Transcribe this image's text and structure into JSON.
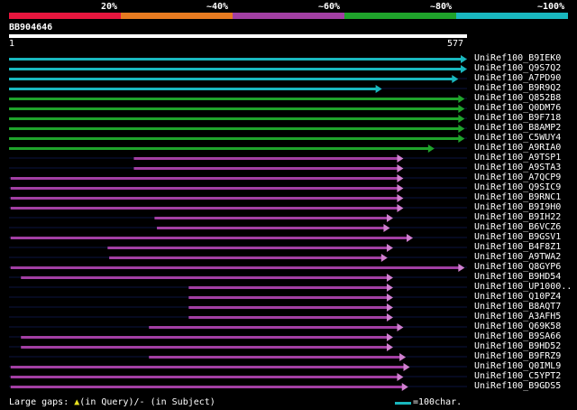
{
  "scale": {
    "labels": [
      "20%",
      "~40%",
      "~60%",
      "~80%",
      "~100%"
    ],
    "segment_colors": [
      "#e8163e",
      "#e87b20",
      "#a23fa3",
      "#1fa32b",
      "#19b7be"
    ]
  },
  "query": {
    "name": "BB904646",
    "start_label": "1",
    "end_label": "577",
    "length": 577
  },
  "footer": {
    "legend_prefix": "Large gaps:",
    "query_gap_text": "(in Query)/",
    "subject_gap_text": "- (in Subject)",
    "scale_text": "=100char.",
    "query_gap_color": "#e8e020",
    "scale_color": "#19b7be"
  },
  "hits": [
    {
      "name": "UniRef100_B9IEK0",
      "start": 1,
      "end": 577,
      "color": "#19b7be",
      "arrow_color": "#19b7be"
    },
    {
      "name": "UniRef100_Q9S7Q2",
      "start": 1,
      "end": 577,
      "color": "#19b7be",
      "arrow_color": "#19b7be"
    },
    {
      "name": "UniRef100_A7PD90",
      "start": 1,
      "end": 566,
      "color": "#19b7be",
      "arrow_color": "#19b7be"
    },
    {
      "name": "UniRef100_B9R9Q2",
      "start": 1,
      "end": 470,
      "color": "#19b7be",
      "arrow_color": "#19b7be"
    },
    {
      "name": "UniRef100_Q852B8",
      "start": 1,
      "end": 574,
      "color": "#1fa32b",
      "arrow_color": "#1fa32b"
    },
    {
      "name": "UniRef100_Q0DM76",
      "start": 1,
      "end": 574,
      "color": "#1fa32b",
      "arrow_color": "#1fa32b"
    },
    {
      "name": "UniRef100_B9F718",
      "start": 1,
      "end": 574,
      "color": "#1fa32b",
      "arrow_color": "#1fa32b"
    },
    {
      "name": "UniRef100_B8AMP2",
      "start": 1,
      "end": 574,
      "color": "#1fa32b",
      "arrow_color": "#1fa32b"
    },
    {
      "name": "UniRef100_C5WUY4",
      "start": 1,
      "end": 574,
      "color": "#1fa32b",
      "arrow_color": "#1fa32b"
    },
    {
      "name": "UniRef100_A9RIA0",
      "start": 1,
      "end": 536,
      "color": "#1fa32b",
      "arrow_color": "#1fa32b"
    },
    {
      "name": "UniRef100_A9TSP1",
      "start": 158,
      "end": 497,
      "color": "#a23fa3",
      "arrow_color": "#d07fd0"
    },
    {
      "name": "UniRef100_A9STA3",
      "start": 158,
      "end": 497,
      "color": "#a23fa3",
      "arrow_color": "#d07fd0"
    },
    {
      "name": "UniRef100_A7QCP9",
      "start": 3,
      "end": 497,
      "color": "#a23fa3",
      "arrow_color": "#d07fd0"
    },
    {
      "name": "UniRef100_Q9SIC9",
      "start": 3,
      "end": 497,
      "color": "#a23fa3",
      "arrow_color": "#d07fd0"
    },
    {
      "name": "UniRef100_B9RNC1",
      "start": 3,
      "end": 497,
      "color": "#a23fa3",
      "arrow_color": "#d07fd0"
    },
    {
      "name": "UniRef100_B9I9H0",
      "start": 3,
      "end": 497,
      "color": "#a23fa3",
      "arrow_color": "#d07fd0"
    },
    {
      "name": "UniRef100_B9IH22",
      "start": 184,
      "end": 484,
      "color": "#a23fa3",
      "arrow_color": "#d07fd0"
    },
    {
      "name": "UniRef100_B6VCZ6",
      "start": 187,
      "end": 480,
      "color": "#a23fa3",
      "arrow_color": "#d07fd0"
    },
    {
      "name": "UniRef100_B9GSV1",
      "start": 3,
      "end": 509,
      "color": "#a23fa3",
      "arrow_color": "#d07fd0"
    },
    {
      "name": "UniRef100_B4F8Z1",
      "start": 125,
      "end": 484,
      "color": "#a23fa3",
      "arrow_color": "#d07fd0"
    },
    {
      "name": "UniRef100_A9TWA2",
      "start": 127,
      "end": 477,
      "color": "#a23fa3",
      "arrow_color": "#d07fd0"
    },
    {
      "name": "UniRef100_Q8GYP6",
      "start": 3,
      "end": 574,
      "color": "#a23fa3",
      "arrow_color": "#d07fd0"
    },
    {
      "name": "UniRef100_B9HD54",
      "start": 16,
      "end": 484,
      "color": "#a23fa3",
      "arrow_color": "#d07fd0"
    },
    {
      "name": "UniRef100_UP1000..",
      "start": 227,
      "end": 484,
      "color": "#a23fa3",
      "arrow_color": "#d07fd0"
    },
    {
      "name": "UniRef100_Q10PZ4",
      "start": 227,
      "end": 484,
      "color": "#a23fa3",
      "arrow_color": "#d07fd0"
    },
    {
      "name": "UniRef100_B8AQT7",
      "start": 227,
      "end": 484,
      "color": "#a23fa3",
      "arrow_color": "#d07fd0"
    },
    {
      "name": "UniRef100_A3AFH5",
      "start": 227,
      "end": 484,
      "color": "#a23fa3",
      "arrow_color": "#d07fd0"
    },
    {
      "name": "UniRef100_Q69K58",
      "start": 177,
      "end": 497,
      "color": "#a23fa3",
      "arrow_color": "#d07fd0"
    },
    {
      "name": "UniRef100_B9SA66",
      "start": 16,
      "end": 484,
      "color": "#a23fa3",
      "arrow_color": "#d07fd0"
    },
    {
      "name": "UniRef100_B9HD52",
      "start": 16,
      "end": 484,
      "color": "#a23fa3",
      "arrow_color": "#d07fd0"
    },
    {
      "name": "UniRef100_B9FRZ9",
      "start": 177,
      "end": 500,
      "color": "#a23fa3",
      "arrow_color": "#d07fd0"
    },
    {
      "name": "UniRef100_Q0IML9",
      "start": 3,
      "end": 505,
      "color": "#a23fa3",
      "arrow_color": "#d07fd0"
    },
    {
      "name": "UniRef100_C5YPT2",
      "start": 3,
      "end": 497,
      "color": "#a23fa3",
      "arrow_color": "#d07fd0"
    },
    {
      "name": "UniRef100_B9GDS5",
      "start": 3,
      "end": 503,
      "color": "#a23fa3",
      "arrow_color": "#d07fd0"
    }
  ]
}
